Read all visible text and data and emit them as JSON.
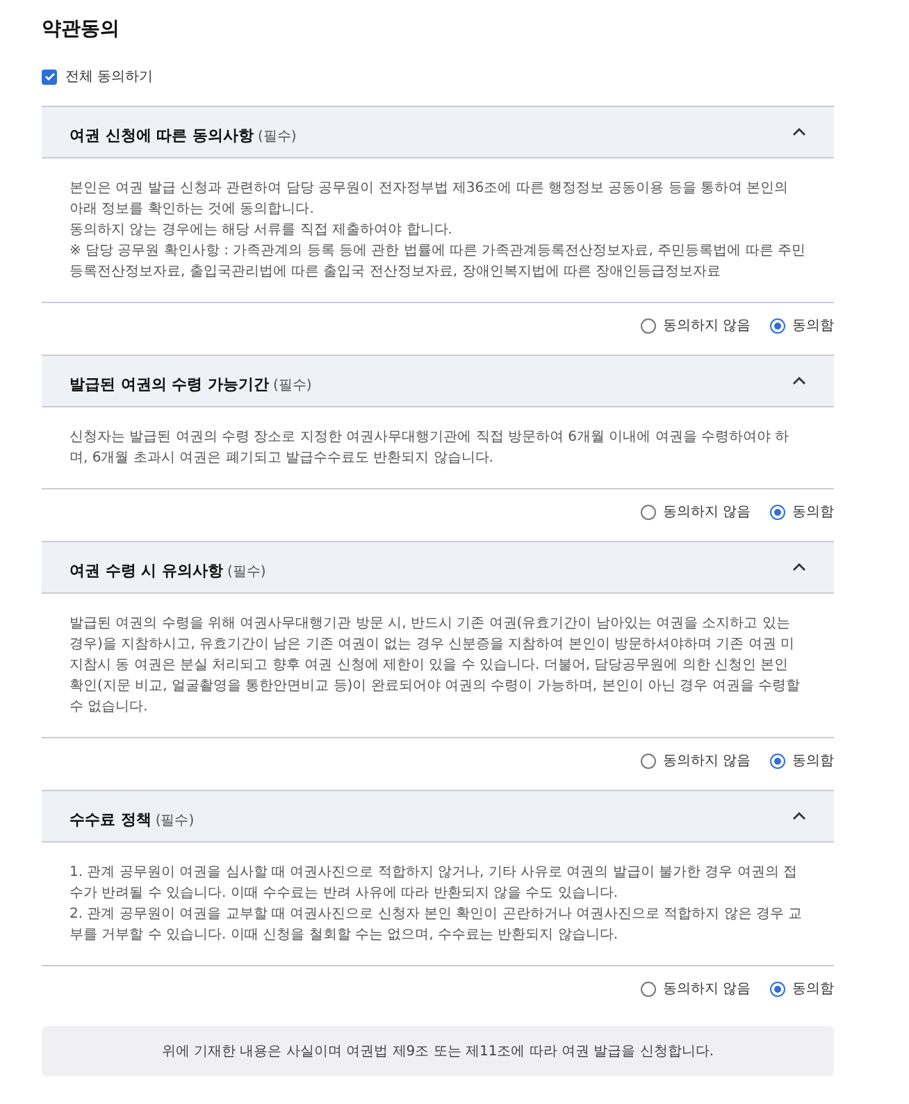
{
  "title": "약관동의",
  "agree_all": {
    "label": "전체 동의하기",
    "checked": true
  },
  "sections": [
    {
      "title": "여권 신청에 따른 동의사항",
      "tag": "(필수)",
      "expanded": true,
      "paragraphs": [
        "본인은 여권 발급 신청과 관련하여 담당 공무원이 전자정부법 제36조에 따른 행정정보 공동이용 등을 통하여 본인의 아래 정보를 확인하는 것에 동의합니다.",
        "동의하지 않는 경우에는 해당 서류를 직접 제출하여야 합니다.",
        "※ 담당 공무원 확인사항 : 가족관계의 등록 등에 관한 법률에 따른 가족관계등록전산정보자료, 주민등록법에 따른 주민등록전산정보자료, 출입국관리법에 따른 출입국 전산정보자료, 장애인복지법에 따른 장애인등급정보자료"
      ],
      "options": [
        {
          "label": "동의하지 않음",
          "selected": false
        },
        {
          "label": "동의함",
          "selected": true
        }
      ]
    },
    {
      "title": "발급된 여권의 수령 가능기간",
      "tag": "(필수)",
      "expanded": true,
      "paragraphs": [
        "신청자는 발급된 여권의 수령 장소로 지정한 여권사무대행기관에 직접 방문하여 6개월 이내에 여권을 수령하여야 하며, 6개월 초과시 여권은 폐기되고 발급수수료도 반환되지 않습니다."
      ],
      "options": [
        {
          "label": "동의하지 않음",
          "selected": false
        },
        {
          "label": "동의함",
          "selected": true
        }
      ]
    },
    {
      "title": "여권 수령 시 유의사항",
      "tag": "(필수)",
      "expanded": true,
      "paragraphs": [
        "발급된 여권의 수령을 위해 여권사무대행기관 방문 시, 반드시 기존 여권(유효기간이 남아있는 여권을 소지하고 있는 경우)을 지참하시고, 유효기간이 남은 기존 여권이 없는 경우 신분증을 지참하여 본인이 방문하셔야하며 기존 여권 미지참시 동 여권은 분실 처리되고 향후 여권 신청에 제한이 있을 수 있습니다. 더불어, 담당공무원에 의한 신청인 본인 확인(지문 비교, 얼굴촬영을 통한안면비교 등)이 완료되어야 여권의 수령이 가능하며, 본인이 아닌 경우 여권을 수령할 수 없습니다."
      ],
      "options": [
        {
          "label": "동의하지 않음",
          "selected": false
        },
        {
          "label": "동의함",
          "selected": true
        }
      ]
    },
    {
      "title": "수수료 정책",
      "tag": "(필수)",
      "expanded": true,
      "paragraphs": [
        "1. 관계 공무원이 여권을 심사할 때 여권사진으로 적합하지 않거나, 기타 사유로 여권의 발급이 불가한 경우 여권의 접수가 반려될 수 있습니다. 이때 수수료는 반려 사유에 따라 반환되지 않을 수도 있습니다.",
        "2. 관계 공무원이 여권을 교부할 때 여권사진으로 신청자 본인 확인이 곤란하거나 여권사진으로 적합하지 않은 경우 교부를 거부할 수 있습니다. 이때 신청을 철회할 수는 없으며, 수수료는 반환되지 않습니다."
      ],
      "options": [
        {
          "label": "동의하지 않음",
          "selected": false
        },
        {
          "label": "동의함",
          "selected": true
        }
      ]
    }
  ],
  "notice": "위에 기재한 내용은 사실이며 여권법 제9조 또는 제11조에 따라 여권 발급을 신청합니다."
}
